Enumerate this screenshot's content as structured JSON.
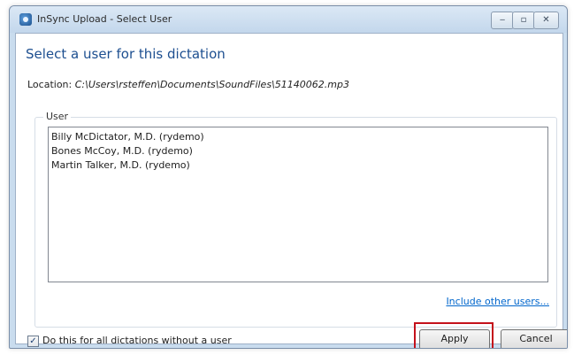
{
  "window": {
    "title": "InSync Upload - Select User",
    "controls": {
      "minimize": "‒",
      "maximize": "▫",
      "close": "✕"
    }
  },
  "dialog": {
    "heading": "Select a user for this dictation",
    "location_label": "Location:",
    "location_path": "C:\\Users\\rsteffen\\Documents\\SoundFiles\\51140062.mp3",
    "group_label": "User",
    "users": [
      "Billy McDictator, M.D. (rydemo)",
      "Bones McCoy, M.D. (rydemo)",
      "Martin Talker, M.D. (rydemo)"
    ],
    "include_link": "Include other users...",
    "checkbox_label": "Do this for all dictations without a user",
    "checkbox_checked": true,
    "checkbox_mark": "✓",
    "apply_label": "Apply",
    "cancel_label": "Cancel"
  },
  "colors": {
    "heading": "#1d4f90",
    "link": "#0066cc",
    "highlight": "#c4111b"
  }
}
